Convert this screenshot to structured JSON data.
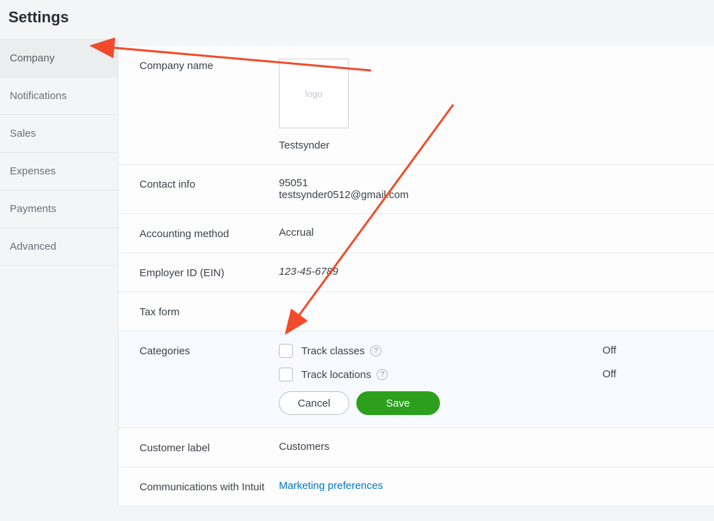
{
  "title": "Settings",
  "sidebar": [
    {
      "label": "Company",
      "active": true
    },
    {
      "label": "Notifications",
      "active": false
    },
    {
      "label": "Sales",
      "active": false
    },
    {
      "label": "Expenses",
      "active": false
    },
    {
      "label": "Payments",
      "active": false
    },
    {
      "label": "Advanced",
      "active": false
    }
  ],
  "company_name": {
    "label": "Company name",
    "logo_placeholder": "logo",
    "value": "Testsynder"
  },
  "contact_info": {
    "label": "Contact info",
    "zip": "95051",
    "email": "testsynder0512@gmail.com"
  },
  "accounting": {
    "label": "Accounting method",
    "value": "Accrual"
  },
  "ein": {
    "label": "Employer ID (EIN)",
    "placeholder": "123-45-6789"
  },
  "tax_form": {
    "label": "Tax form"
  },
  "categories": {
    "label": "Categories",
    "track_classes": {
      "label": "Track classes",
      "status": "Off"
    },
    "track_locations": {
      "label": "Track locations",
      "status": "Off"
    },
    "cancel": "Cancel",
    "save": "Save"
  },
  "customer_label": {
    "label": "Customer label",
    "value": "Customers"
  },
  "communications": {
    "label": "Communications with Intuit",
    "link": "Marketing preferences"
  },
  "help_glyph": "?"
}
